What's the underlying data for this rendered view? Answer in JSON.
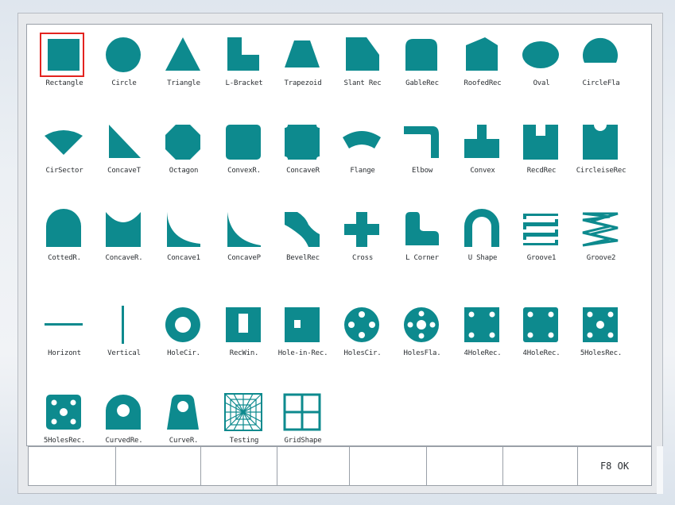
{
  "colors": {
    "shape_fill": "#0d8a8e",
    "selection": "#e3231f"
  },
  "selected_index": 0,
  "shapes": [
    {
      "label": "Rectangle",
      "icon": "rectangle-icon"
    },
    {
      "label": "Circle",
      "icon": "circle-icon"
    },
    {
      "label": "Triangle",
      "icon": "triangle-icon"
    },
    {
      "label": "L-Bracket",
      "icon": "l-bracket-icon"
    },
    {
      "label": "Trapezoid",
      "icon": "trapezoid-icon"
    },
    {
      "label": "Slant Rec",
      "icon": "slant-rect-icon"
    },
    {
      "label": "GableRec",
      "icon": "gable-rect-icon"
    },
    {
      "label": "RoofedRec",
      "icon": "roofed-rect-icon"
    },
    {
      "label": "Oval",
      "icon": "oval-icon"
    },
    {
      "label": "CircleFla",
      "icon": "circle-flat-icon"
    },
    {
      "label": "CirSector",
      "icon": "cir-sector-icon"
    },
    {
      "label": "ConcaveT",
      "icon": "concave-triangle-icon"
    },
    {
      "label": "Octagon",
      "icon": "octagon-icon"
    },
    {
      "label": "ConvexR.",
      "icon": "convex-rect-icon"
    },
    {
      "label": "ConcaveR",
      "icon": "concave-rect-icon"
    },
    {
      "label": "Flange",
      "icon": "flange-icon"
    },
    {
      "label": "Elbow",
      "icon": "elbow-icon"
    },
    {
      "label": "Convex",
      "icon": "convex-icon"
    },
    {
      "label": "RecdRec",
      "icon": "recd-rect-icon"
    },
    {
      "label": "CircleiseRec",
      "icon": "circle-notch-rect-icon"
    },
    {
      "label": "CottedR.",
      "icon": "cotted-rect-icon"
    },
    {
      "label": "ConcaveR.",
      "icon": "concave-arc-rect-icon"
    },
    {
      "label": "Concave1",
      "icon": "concave-1-icon"
    },
    {
      "label": "ConcaveP",
      "icon": "concave-p-icon"
    },
    {
      "label": "BevelRec",
      "icon": "bevel-rect-icon"
    },
    {
      "label": "Cross",
      "icon": "cross-icon"
    },
    {
      "label": "L Corner",
      "icon": "l-corner-icon"
    },
    {
      "label": "U Shape",
      "icon": "u-shape-icon"
    },
    {
      "label": "Groove1",
      "icon": "groove-1-icon"
    },
    {
      "label": "Groove2",
      "icon": "groove-2-icon"
    },
    {
      "label": "Horizont",
      "icon": "horizontal-line-icon"
    },
    {
      "label": "Vertical",
      "icon": "vertical-line-icon"
    },
    {
      "label": "HoleCir.",
      "icon": "hole-circle-icon"
    },
    {
      "label": "RecWin.",
      "icon": "rect-window-icon"
    },
    {
      "label": "Hole-in-Rec.",
      "icon": "hole-in-rect-icon"
    },
    {
      "label": "HolesCir.",
      "icon": "holes-circle-icon"
    },
    {
      "label": "HolesFla.",
      "icon": "holes-flange-icon"
    },
    {
      "label": "4HoleRec.",
      "icon": "four-hole-rect-icon"
    },
    {
      "label": "4HoleRec.",
      "icon": "four-hole-rect-2-icon"
    },
    {
      "label": "5HolesRec.",
      "icon": "five-hole-rect-icon"
    },
    {
      "label": "5HolesRec.",
      "icon": "five-hole-rect-2-icon"
    },
    {
      "label": "CurvedRe.",
      "icon": "curved-rect-icon"
    },
    {
      "label": "CurveR.",
      "icon": "curve-r-icon"
    },
    {
      "label": "Testing",
      "icon": "testing-grid-icon"
    },
    {
      "label": "GridShape",
      "icon": "grid-shape-icon"
    }
  ],
  "function_keys": [
    "",
    "",
    "",
    "",
    "",
    "",
    "",
    "F8 OK"
  ]
}
